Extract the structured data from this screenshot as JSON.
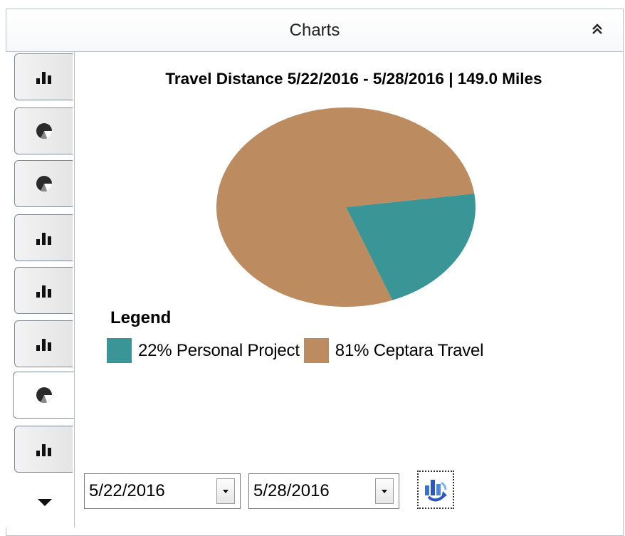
{
  "panel": {
    "title": "Charts",
    "collapse_icon": "double-chevron-up-icon"
  },
  "side_tabs": [
    {
      "icon": "bar-chart-icon",
      "active": false
    },
    {
      "icon": "pie-chart-icon",
      "active": false
    },
    {
      "icon": "pie-chart-icon",
      "active": false
    },
    {
      "icon": "bar-chart-icon",
      "active": false
    },
    {
      "icon": "bar-chart-icon",
      "active": false
    },
    {
      "icon": "bar-chart-icon",
      "active": false
    },
    {
      "icon": "pie-chart-icon",
      "active": true
    },
    {
      "icon": "bar-chart-icon",
      "active": false
    }
  ],
  "legend": {
    "title": "Legend",
    "items": [
      {
        "label": "22% Personal Project",
        "color": "#3a9597"
      },
      {
        "label": "81% Ceptara Travel",
        "color": "#bc8c60"
      }
    ]
  },
  "filters": {
    "start_date": "5/22/2016",
    "end_date": "5/28/2016",
    "refresh_icon": "refresh-chart-icon"
  },
  "chart_data": {
    "type": "pie",
    "title": "Travel Distance 5/22/2016 - 5/28/2016 | 149.0 Miles",
    "slices": [
      {
        "label": "Personal Project",
        "value": 22,
        "color": "#3a9597"
      },
      {
        "label": "Ceptara Travel",
        "value": 81,
        "color": "#bc8c60"
      }
    ]
  }
}
